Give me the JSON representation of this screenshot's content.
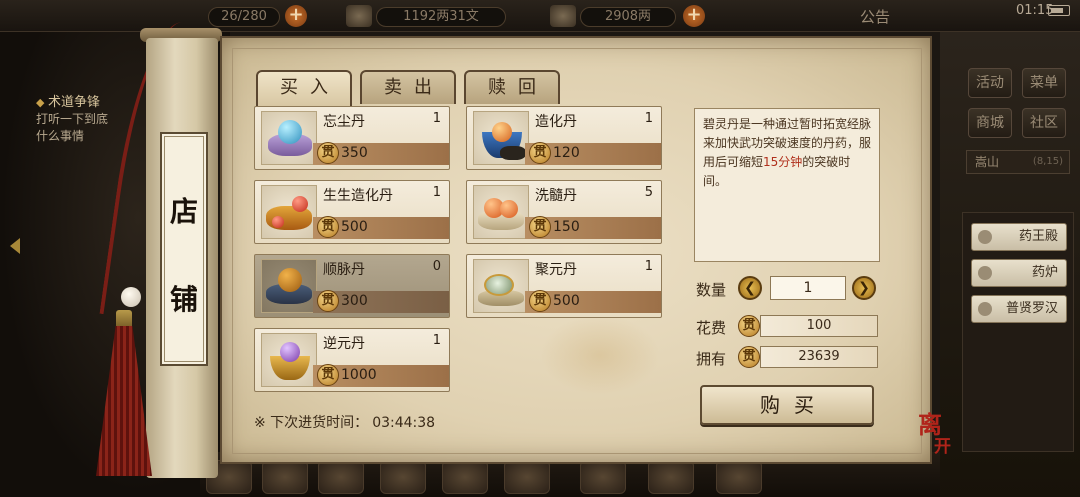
{
  "hud": {
    "capacity": "26/280",
    "silver": "1192两31文",
    "gold": "2908两",
    "announce": "公告",
    "time": "01:15"
  },
  "quest": {
    "title": "术道争锋",
    "line1": "打听一下到底",
    "line2": "什么事情"
  },
  "sidebar": {
    "buttons": [
      "活动",
      "菜单",
      "商城",
      "社区"
    ],
    "location": "嵩山",
    "location_coord": "(8,15)",
    "npcs": [
      "药王殿",
      "药炉",
      "普贤罗汉"
    ]
  },
  "scroll": {
    "chars": [
      "店",
      "铺"
    ]
  },
  "tabs": [
    {
      "label": "买入",
      "active": true
    },
    {
      "label": "卖出",
      "active": false
    },
    {
      "label": "赎回",
      "active": false
    }
  ],
  "currency_glyph": "贯",
  "items": [
    {
      "name": "忘尘丹",
      "qty": "1",
      "price": "350",
      "dim": false
    },
    {
      "name": "造化丹",
      "qty": "1",
      "price": "120",
      "dim": false
    },
    {
      "name": "生生造化丹",
      "qty": "1",
      "price": "500",
      "dim": false
    },
    {
      "name": "洗髓丹",
      "qty": "5",
      "price": "150",
      "dim": false
    },
    {
      "name": "顺脉丹",
      "qty": "0",
      "price": "300",
      "dim": true
    },
    {
      "name": "聚元丹",
      "qty": "1",
      "price": "500",
      "dim": false
    },
    {
      "name": "逆元丹",
      "qty": "1",
      "price": "1000",
      "dim": false
    }
  ],
  "restock": {
    "label": "※ 下次进货时间：",
    "time": "03:44:38"
  },
  "description": {
    "before": "碧灵丹是一种通过暂时拓宽经脉来加快武功突破速度的丹药，服用后可缩短",
    "highlight": "15分钟",
    "after": "的突破时间。"
  },
  "purchase": {
    "qty_label": "数量",
    "qty_value": "1",
    "cost_label": "花费",
    "cost_value": "100",
    "own_label": "拥有",
    "own_value": "23639",
    "buy_label": "购买",
    "qty_dec_icon": "chevron-left",
    "qty_inc_icon": "chevron-right"
  },
  "leave": {
    "line1": "离",
    "line2": "开"
  }
}
